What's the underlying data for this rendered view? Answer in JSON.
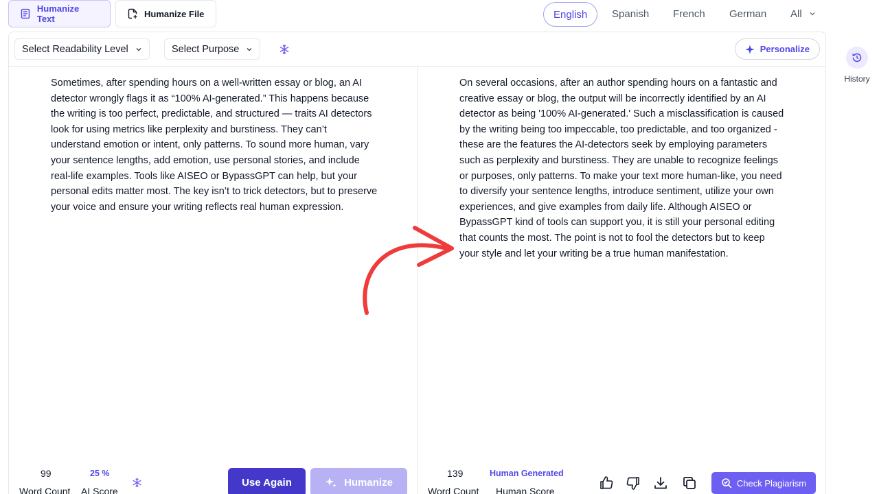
{
  "tabs": {
    "humanize_text": "Humanize Text",
    "humanize_file": "Humanize File"
  },
  "languages": [
    "English",
    "Spanish",
    "French",
    "German",
    "All"
  ],
  "toolbar": {
    "readability": "Select Readability Level",
    "purpose": "Select Purpose",
    "personalize": "Personalize"
  },
  "input": {
    "text": "Sometimes, after spending hours on a well-written essay or blog, an AI detector wrongly flags it as “100% AI-generated.” This happens because the writing is too perfect, predictable, and structured — traits AI detectors look for using metrics like perplexity and burstiness. They can’t understand emotion or intent, only patterns. To sound more human, vary your sentence lengths, add emotion, use personal stories, and include real-life examples. Tools like AISEO or BypassGPT can help, but your personal edits matter most. The key isn’t to trick detectors, but to preserve your voice and ensure your writing reflects real human expression.",
    "word_count": "99",
    "word_count_label": "Word Count",
    "ai_score": "25 %",
    "ai_score_label": "AI Score"
  },
  "output": {
    "text": "On several occasions, after an author spending hours on a fantastic and creative essay or blog, the output will be incorrectly identified by an AI detector as being '100% AI-generated.' Such a misclassification is caused by the writing being too impeccable, too predictable, and too organized - these are the features the AI-detectors seek by employing parameters such as perplexity and burstiness. They are unable to recognize feelings or purposes, only patterns. To make your text more human-like, you need to diversify your sentence lengths, introduce sentiment, utilize your own experiences, and give examples from daily life. Although AISEO or BypassGPT kind of tools can support you, it is still your personal editing that counts the most. The point is not to fool the detectors but to keep your style and let your writing be a true human manifestation.",
    "word_count": "139",
    "word_count_label": "Word Count",
    "human_score": "Human Generated",
    "human_score_label": "Human Score"
  },
  "buttons": {
    "use_again": "Use Again",
    "humanize": "Humanize",
    "check_plagiarism": "Check Plagiarism"
  },
  "history": {
    "label": "History"
  },
  "colors": {
    "accent": "#4f46e5",
    "primary_button": "#4338ca",
    "disabled_button": "#b8b2f5",
    "arrow": "#ef3b3b"
  }
}
